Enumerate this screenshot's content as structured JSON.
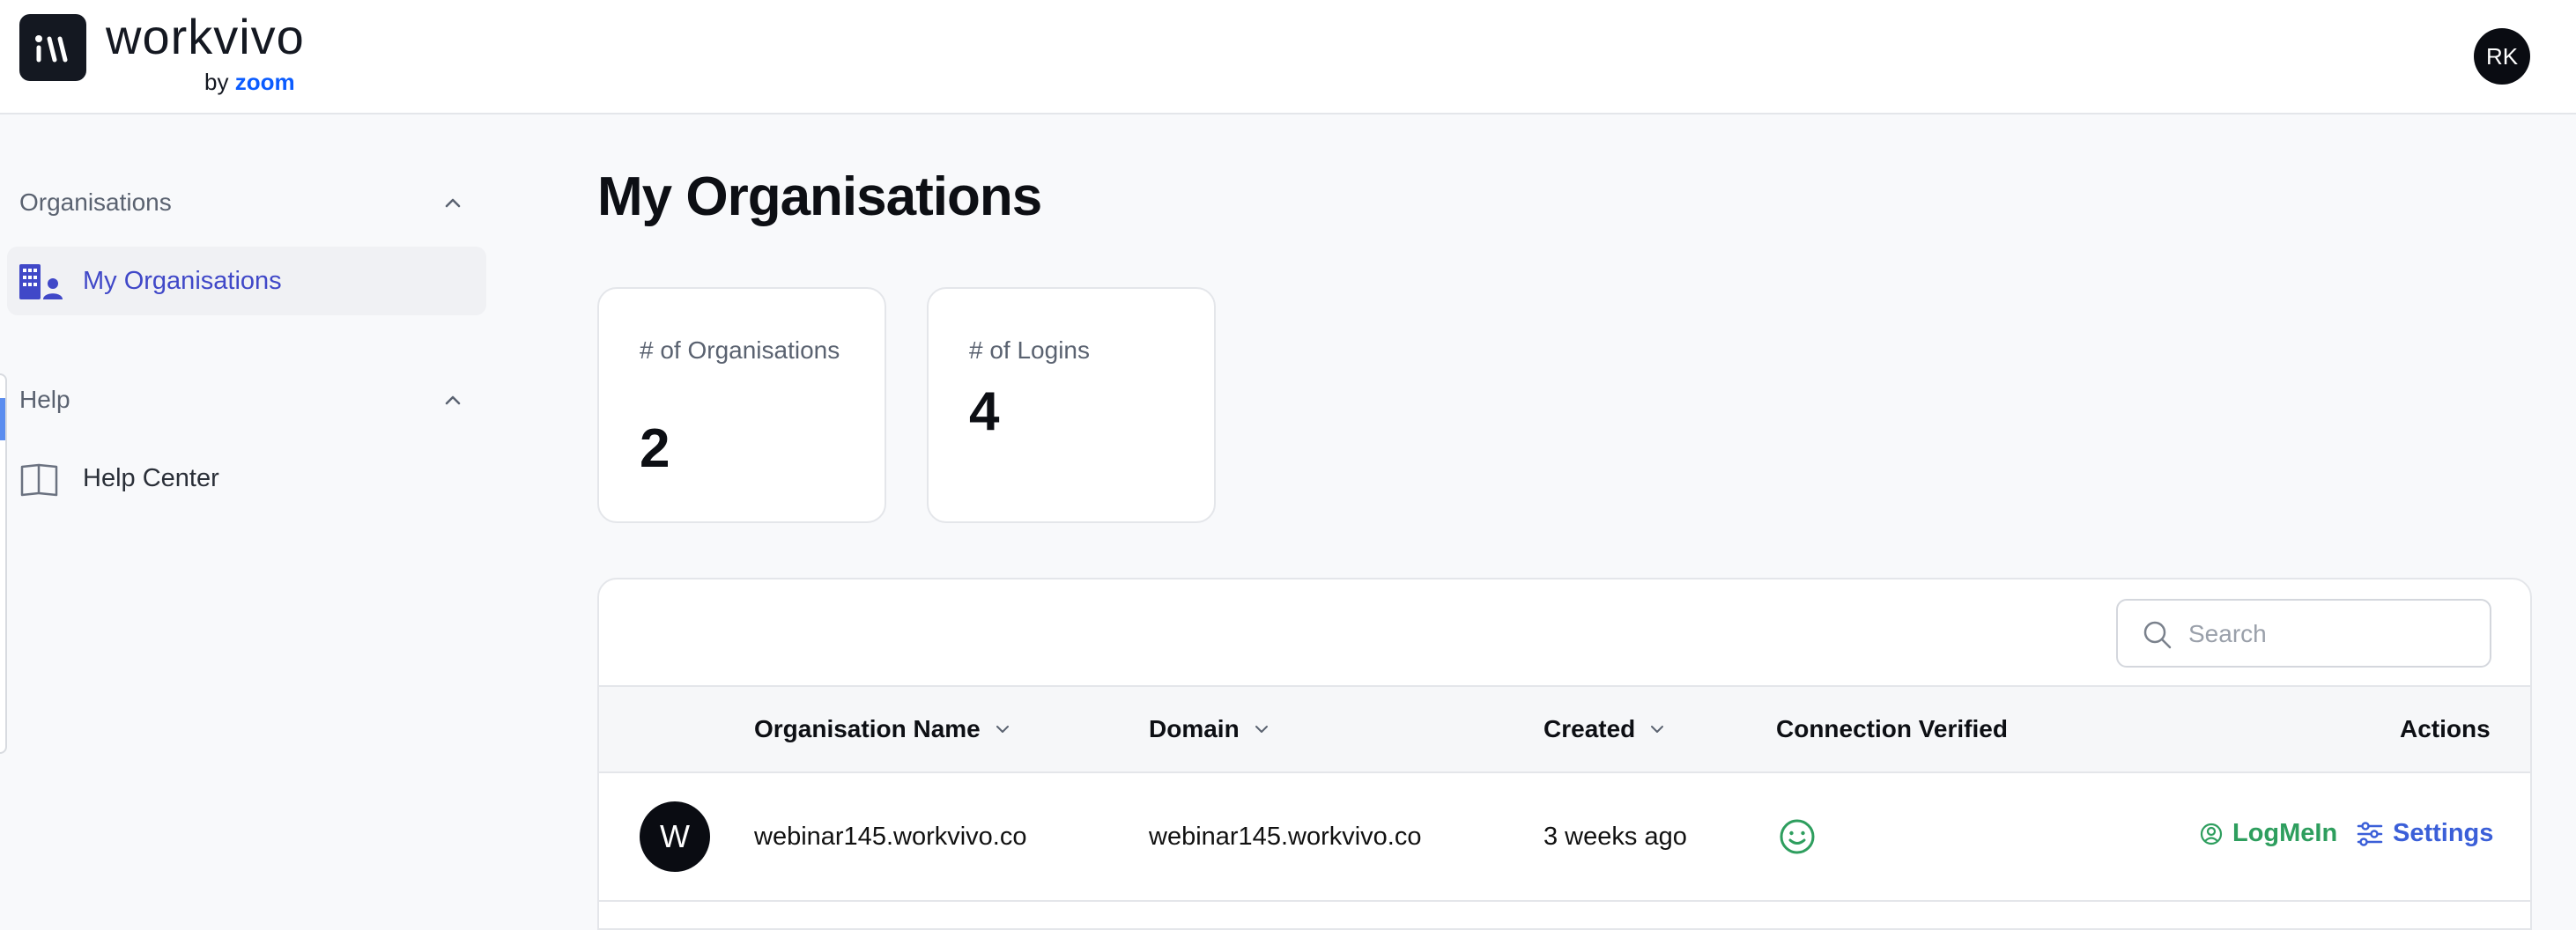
{
  "brand": {
    "wordmark": "workvivo",
    "by": "by",
    "partner": "zoom"
  },
  "user": {
    "initials": "RK"
  },
  "sidebar": {
    "sections": [
      {
        "title": "Organisations",
        "items": [
          {
            "label": "My Organisations",
            "icon": "building-users-icon",
            "active": true
          }
        ]
      },
      {
        "title": "Help",
        "items": [
          {
            "label": "Help Center",
            "icon": "book-open-icon",
            "active": false
          }
        ]
      }
    ]
  },
  "main": {
    "title": "My Organisations",
    "stats": [
      {
        "label": "# of Organisations",
        "value": "2"
      },
      {
        "label": "# of Logins",
        "value": "4"
      }
    ],
    "search": {
      "placeholder": "Search",
      "value": ""
    },
    "table": {
      "columns": [
        "Organisation Name",
        "Domain",
        "Created",
        "Connection Verified",
        "Actions"
      ],
      "rows": [
        {
          "avatar": "W",
          "name": "webinar145.workvivo.co",
          "domain": "webinar145.workvivo.co",
          "created": "3 weeks ago",
          "verified_icon": "smile-icon",
          "actions": {
            "login": "LogMeIn",
            "settings": "Settings"
          }
        }
      ]
    }
  },
  "colors": {
    "accent": "#4048c8",
    "login_green": "#2e9e5e",
    "settings_blue": "#3b5fd8",
    "zoom_blue": "#0b5cff"
  }
}
